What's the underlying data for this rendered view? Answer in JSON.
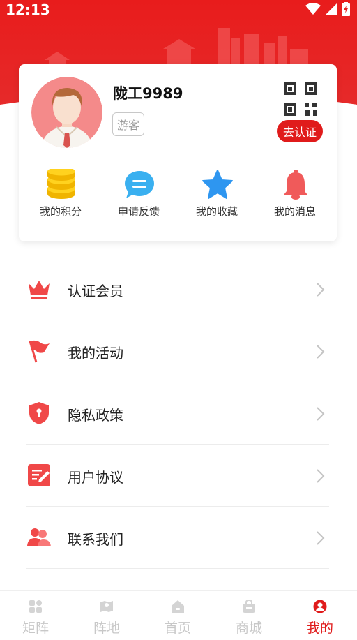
{
  "status_bar": {
    "time": "12:13"
  },
  "colors": {
    "brand_red": "#e62222",
    "accent": "#e01b1b",
    "inactive_nav": "#c8c8c8"
  },
  "profile": {
    "name": "陇工9989",
    "badge": "游客",
    "verify_label": "去认证",
    "quick_actions": [
      {
        "label": "我的积分",
        "icon": "coins-icon"
      },
      {
        "label": "申请反馈",
        "icon": "feedback-chat-icon"
      },
      {
        "label": "我的收藏",
        "icon": "star-icon"
      },
      {
        "label": "我的消息",
        "icon": "bell-icon"
      }
    ]
  },
  "menu": {
    "items": [
      {
        "label": "认证会员",
        "icon": "crown-icon"
      },
      {
        "label": "我的活动",
        "icon": "flag-icon"
      },
      {
        "label": "隐私政策",
        "icon": "shield-icon"
      },
      {
        "label": "用户协议",
        "icon": "agreement-icon"
      },
      {
        "label": "联系我们",
        "icon": "contacts-icon"
      }
    ]
  },
  "bottom_nav": {
    "items": [
      {
        "label": "矩阵",
        "icon": "grid-icon"
      },
      {
        "label": "阵地",
        "icon": "map-icon"
      },
      {
        "label": "首页",
        "icon": "home-icon"
      },
      {
        "label": "商城",
        "icon": "shop-bag-icon"
      },
      {
        "label": "我的",
        "icon": "user-icon"
      }
    ],
    "active": "我的"
  }
}
